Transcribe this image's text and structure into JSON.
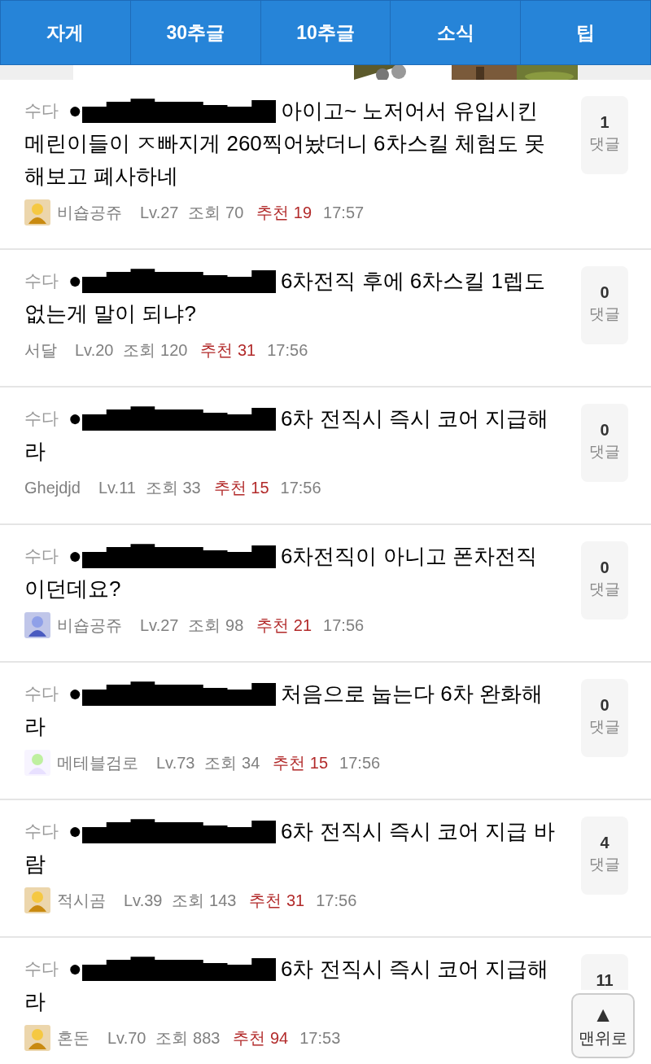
{
  "tabs": [
    {
      "label": "자게",
      "selected": false
    },
    {
      "label": "30추글",
      "selected": false
    },
    {
      "label": "10추글",
      "selected": false
    },
    {
      "label": "소식",
      "selected": false
    },
    {
      "label": "팁",
      "selected": false
    }
  ],
  "posts": [
    {
      "category": "수다",
      "bullet": "●",
      "title_lines": [
        "아이고~ 노저어서 유입시킨",
        "메린이들이 ㅈ빠지게 260찍어놨더니 6차스킬 체험도 못",
        "해보고 폐사하네"
      ],
      "avatar": true,
      "author": "비숍공쥬",
      "level": "Lv.27",
      "views_label": "조회",
      "views": "70",
      "likes_label": "추천",
      "likes": "19",
      "time": "17:57",
      "comments": "1",
      "comment_label": "댓글"
    },
    {
      "category": "수다",
      "bullet": "●",
      "title_lines": [
        "6차전직 후에 6차스킬 1렙도",
        "없는게 말이 되냐?"
      ],
      "avatar": false,
      "author": "서달",
      "level": "Lv.20",
      "views_label": "조회",
      "views": "120",
      "likes_label": "추천",
      "likes": "31",
      "time": "17:56",
      "comments": "0",
      "comment_label": "댓글"
    },
    {
      "category": "수다",
      "bullet": "●",
      "title_lines": [
        "6차 전직시 즉시 코어 지급해",
        "라"
      ],
      "avatar": false,
      "author": "Ghejdjd",
      "level": "Lv.11",
      "views_label": "조회",
      "views": "33",
      "likes_label": "추천",
      "likes": "15",
      "time": "17:56",
      "comments": "0",
      "comment_label": "댓글"
    },
    {
      "category": "수다",
      "bullet": "●",
      "title_lines": [
        "6차전직이 아니고 폰차전직",
        "이던데요?"
      ],
      "avatar": true,
      "author": "비숍공쥬",
      "level": "Lv.27",
      "views_label": "조회",
      "views": "98",
      "likes_label": "추천",
      "likes": "21",
      "time": "17:56",
      "comments": "0",
      "comment_label": "댓글"
    },
    {
      "category": "수다",
      "bullet": "●",
      "title_lines": [
        "처음으로 눕는다 6차 완화해",
        "라"
      ],
      "avatar": true,
      "author": "메테블검로",
      "level": "Lv.73",
      "views_label": "조회",
      "views": "34",
      "likes_label": "추천",
      "likes": "15",
      "time": "17:56",
      "comments": "0",
      "comment_label": "댓글"
    },
    {
      "category": "수다",
      "bullet": "●",
      "title_lines": [
        "6차 전직시 즉시 코어 지급 바",
        "람"
      ],
      "avatar": true,
      "author": "적시곰",
      "level": "Lv.39",
      "views_label": "조회",
      "views": "143",
      "likes_label": "추천",
      "likes": "31",
      "time": "17:56",
      "comments": "4",
      "comment_label": "댓글"
    },
    {
      "category": "수다",
      "bullet": "●",
      "title_lines": [
        "6차 전직시 즉시 코어 지급해",
        "라"
      ],
      "avatar": true,
      "author": "혼돈",
      "level": "Lv.70",
      "views_label": "조회",
      "views": "883",
      "likes_label": "추천",
      "likes": "94",
      "time": "17:53",
      "comments": "11"
    }
  ],
  "top_button": {
    "icon": "▲",
    "label": "맨위로"
  }
}
